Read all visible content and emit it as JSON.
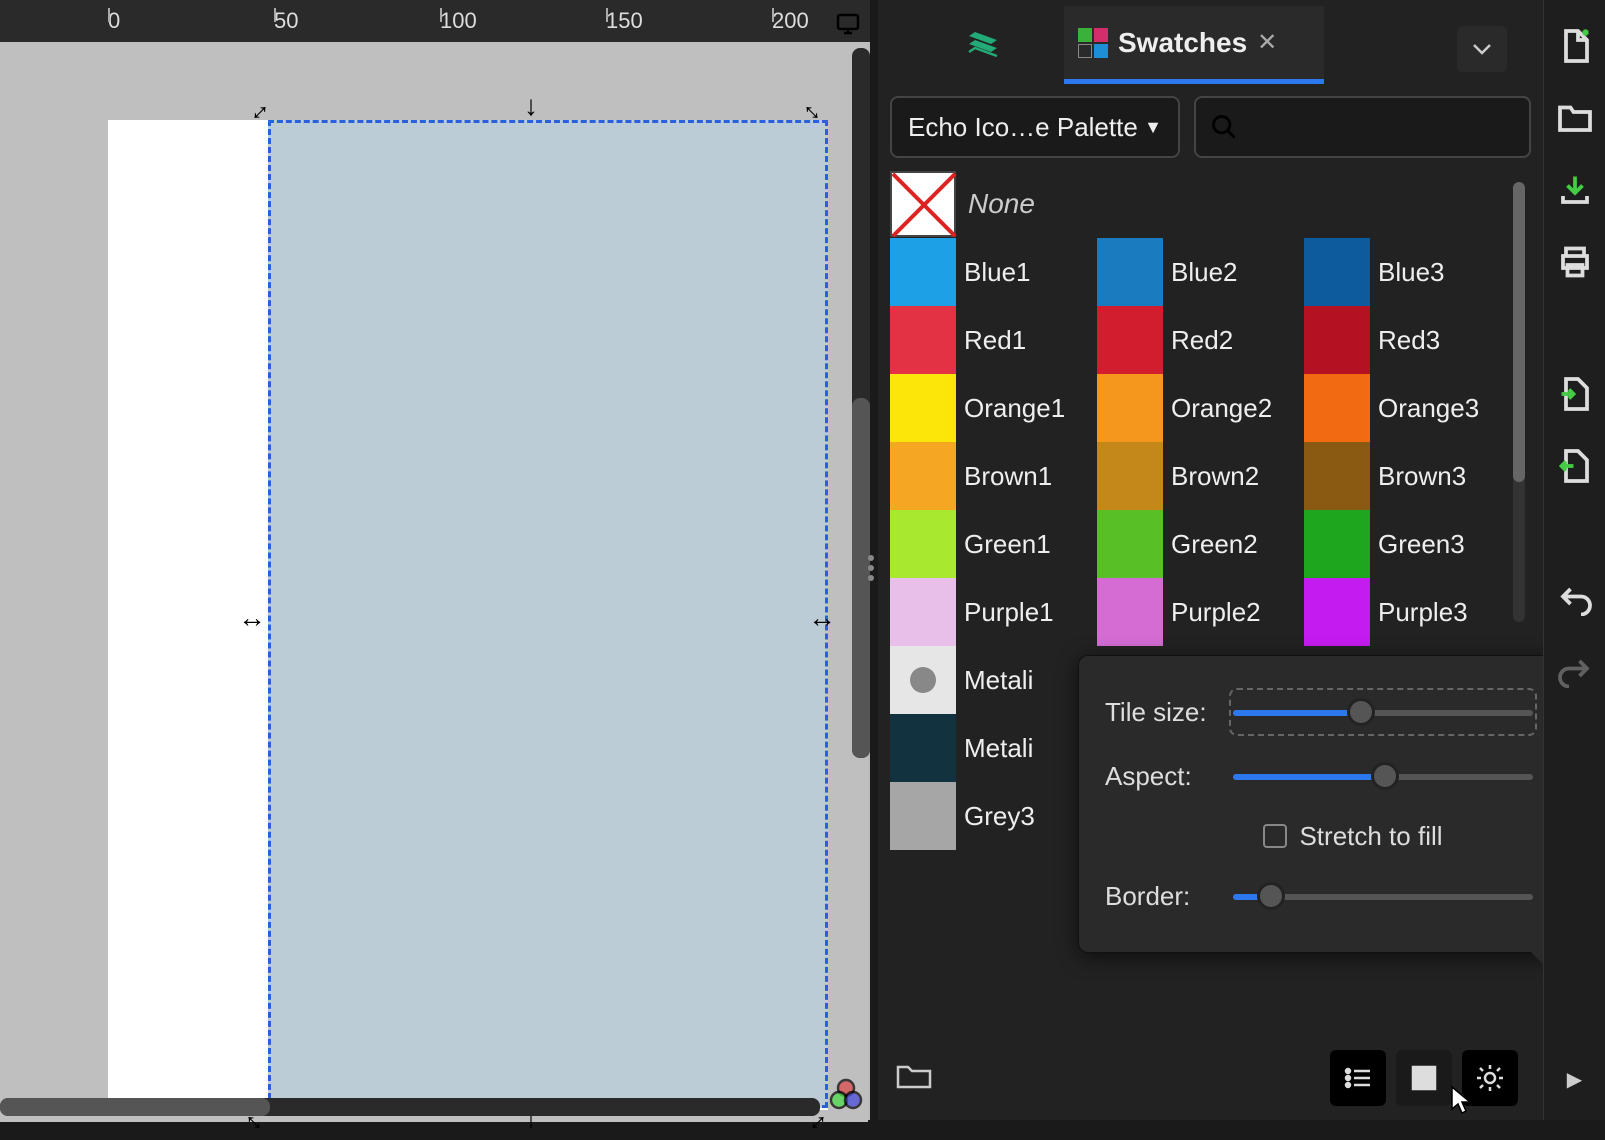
{
  "ruler": {
    "ticks": [
      "0",
      "50",
      "100",
      "150",
      "200"
    ]
  },
  "tabs": {
    "title": "Swatches"
  },
  "palette_dropdown": "Echo Ico…e Palette",
  "none_label": "None",
  "swatches": [
    {
      "label": "Blue1",
      "color": "#1ea0e6"
    },
    {
      "label": "Blue2",
      "color": "#1a7bbf"
    },
    {
      "label": "Blue3",
      "color": "#0d5a9c"
    },
    {
      "label": "Red1",
      "color": "#e33244"
    },
    {
      "label": "Red2",
      "color": "#d21d2f"
    },
    {
      "label": "Red3",
      "color": "#b41222"
    },
    {
      "label": "Orange1",
      "color": "#fce609"
    },
    {
      "label": "Orange2",
      "color": "#f5971c"
    },
    {
      "label": "Orange3",
      "color": "#f26a12"
    },
    {
      "label": "Brown1",
      "color": "#f5a623"
    },
    {
      "label": "Brown2",
      "color": "#c4871a"
    },
    {
      "label": "Brown3",
      "color": "#8a5a12"
    },
    {
      "label": "Green1",
      "color": "#a8e82e"
    },
    {
      "label": "Green2",
      "color": "#58bf26"
    },
    {
      "label": "Green3",
      "color": "#1fa61f"
    },
    {
      "label": "Purple1",
      "color": "#e8bfe8"
    },
    {
      "label": "Purple2",
      "color": "#d46cd4"
    },
    {
      "label": "Purple3",
      "color": "#c41cf0"
    },
    {
      "label": "Metali",
      "color": "#e6e6e6"
    },
    {
      "label": "",
      "color": ""
    },
    {
      "label": "",
      "color": ""
    },
    {
      "label": "Metali",
      "color": "#12323f"
    },
    {
      "label": "",
      "color": ""
    },
    {
      "label": "",
      "color": ""
    },
    {
      "label": "Grey3",
      "color": "#a6a6a6"
    }
  ],
  "popup": {
    "tile_size_label": "Tile size:",
    "tile_size_value": "16",
    "aspect_label": "Aspect:",
    "aspect_value": "0,0",
    "stretch_label": "Stretch to fill",
    "border_label": "Border:",
    "border_value": "1"
  }
}
